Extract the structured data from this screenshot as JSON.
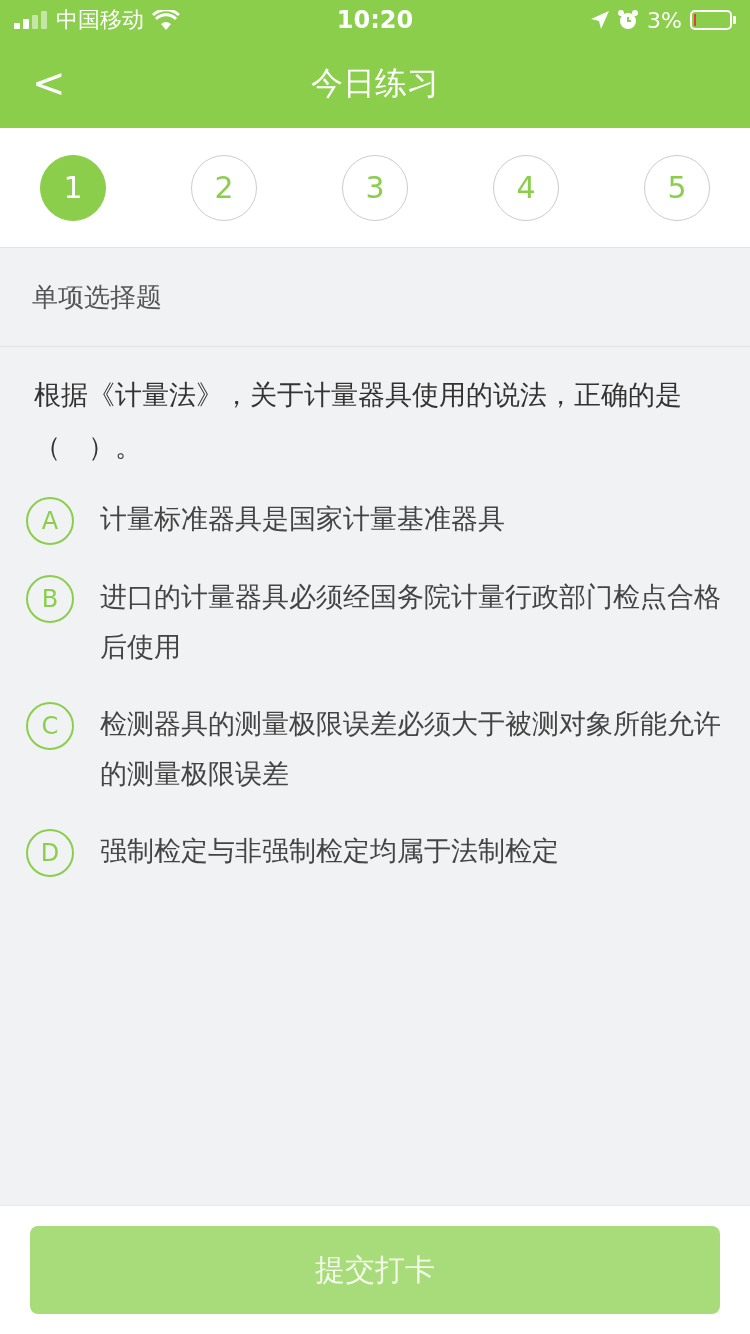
{
  "status_bar": {
    "carrier": "中国移动",
    "time": "10:20",
    "battery": "3%"
  },
  "nav": {
    "back": "<",
    "title": "今日练习"
  },
  "steps": [
    {
      "label": "1",
      "selected": true
    },
    {
      "label": "2",
      "selected": false
    },
    {
      "label": "3",
      "selected": false
    },
    {
      "label": "4",
      "selected": false
    },
    {
      "label": "5",
      "selected": false
    }
  ],
  "section": "单项选择题",
  "question": "根据《计量法》，关于计量器具使用的说法，正确的是（　）。",
  "options": [
    {
      "letter": "A",
      "text": "计量标准器具是国家计量基准器具",
      "selected": false
    },
    {
      "letter": "B",
      "text": "进口的计量器具必须经国务院计量行政部门检点合格后使用",
      "selected": false
    },
    {
      "letter": "C",
      "text": "检测器具的测量极限误差必须大于被测对象所能允许的测量极限误差",
      "selected": false
    },
    {
      "letter": "D",
      "text": "强制检定与非强制检定均属于法制检定",
      "selected": false
    }
  ],
  "submit": {
    "label": "提交打卡",
    "disabled": true
  }
}
